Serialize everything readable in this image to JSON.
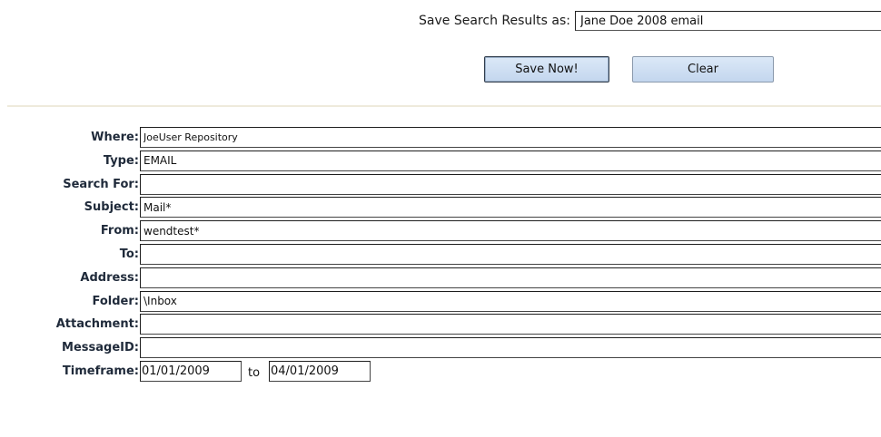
{
  "save_search": {
    "label": "Save Search Results as:",
    "value": "Jane Doe 2008 email",
    "save_button": "Save Now!",
    "clear_button": "Clear"
  },
  "criteria": {
    "where": {
      "label": "Where:",
      "value": "JoeUser Repository"
    },
    "type": {
      "label": "Type:",
      "value": "EMAIL"
    },
    "search_for": {
      "label": "Search For:",
      "value": ""
    },
    "subject": {
      "label": "Subject:",
      "value": "Mail*"
    },
    "from": {
      "label": "From:",
      "value": "wendtest*"
    },
    "to": {
      "label": "To:",
      "value": ""
    },
    "address": {
      "label": "Address:",
      "value": ""
    },
    "folder": {
      "label": "Folder:",
      "value": "\\Inbox"
    },
    "attachment": {
      "label": "Attachment:",
      "value": ""
    },
    "message_id": {
      "label": "MessageID:",
      "value": ""
    },
    "timeframe": {
      "label": "Timeframe:",
      "from": "01/01/2009",
      "separator": "to",
      "to": "04/01/2009"
    }
  }
}
